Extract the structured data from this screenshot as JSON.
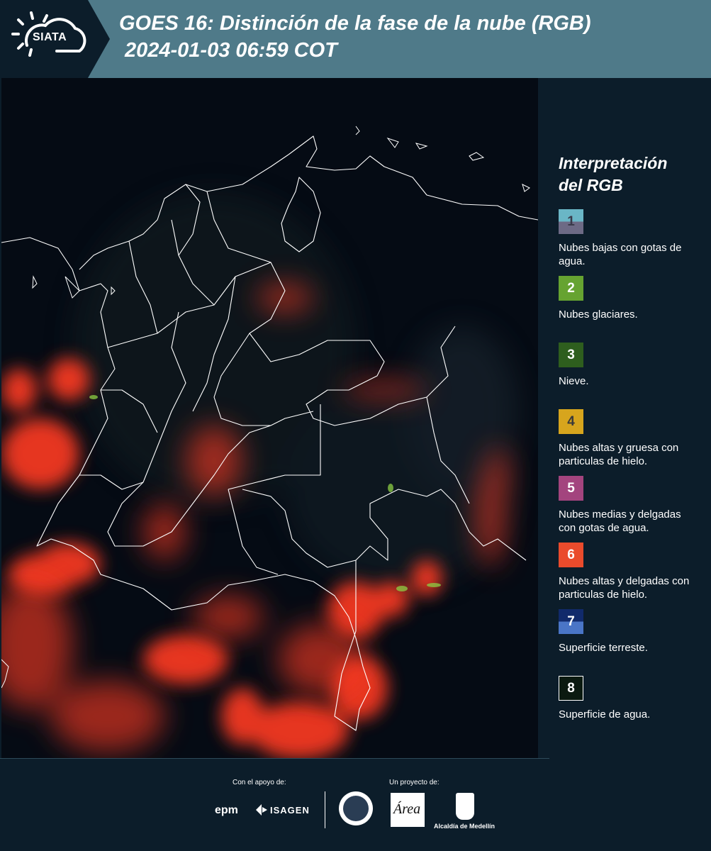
{
  "header": {
    "logo": "SIATA",
    "title_line1": "GOES 16: Distinción de la fase de la nube (RGB)",
    "title_line2": "2024-01-03 06:59 COT"
  },
  "map": {
    "background_color": "#050b14",
    "border_color": "#ffffff",
    "cloud_color": "#ff3b20"
  },
  "legend": {
    "title_line1": "Interpretación",
    "title_line2": "del RGB",
    "items": [
      {
        "number": "1",
        "label": "Nubes bajas con gotas de agua.",
        "color_top": "#6ab6c6",
        "color_bottom": "#6d6a85",
        "num_color": "#3a3a4a"
      },
      {
        "number": "2",
        "label": "Nubes glaciares.",
        "color_top": "#66a331",
        "color_bottom": "#66a331",
        "num_color": "#ffffff"
      },
      {
        "number": "3",
        "label": "Nieve.",
        "color_top": "#2e5e1e",
        "color_bottom": "#2e5e1e",
        "num_color": "#ffffff"
      },
      {
        "number": "4",
        "label": "Nubes altas y gruesa con particulas de hielo.",
        "color_top": "#d7a51d",
        "color_bottom": "#d7a51d",
        "num_color": "#3a3a3a"
      },
      {
        "number": "5",
        "label": "Nubes medias y delgadas con gotas de agua.",
        "color_top": "#a3447e",
        "color_bottom": "#a3447e",
        "num_color": "#ffffff"
      },
      {
        "number": "6",
        "label": "Nubes altas y delgadas con particulas de hielo.",
        "color_top": "#ea4b2c",
        "color_bottom": "#ea4b2c",
        "num_color": "#ffffff"
      },
      {
        "number": "7",
        "label": "Superficie terreste.",
        "color_top": "#112a6b",
        "color_bottom": "#4a75c6",
        "num_color": "#ffffff"
      },
      {
        "number": "8",
        "label": "Superficie de agua.",
        "color_top": "#0b1a10",
        "color_bottom": "#0b1a10",
        "num_color": "#ffffff"
      }
    ]
  },
  "footer": {
    "support_label": "Con el apoyo de:",
    "project_label": "Un proyecto de:",
    "sponsor1": "epm",
    "sponsor2": "ISAGEN",
    "org1": "Área",
    "org2": "Alcaldía de Medellín"
  }
}
